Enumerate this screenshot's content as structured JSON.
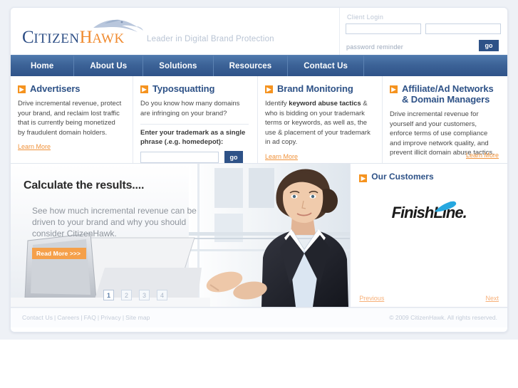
{
  "brand": {
    "name_first": "Citizen",
    "name_second": "Hawk",
    "tagline": "Leader in Digital Brand Protection",
    "hawk_icon": "hawk-icon",
    "accent_orange": "#f5931f",
    "accent_blue": "#2e5287"
  },
  "login": {
    "label": "Client Login",
    "username_value": "",
    "username_placeholder": "",
    "password_value": "",
    "password_placeholder": "",
    "reminder_link": "password reminder",
    "go_label": "go"
  },
  "nav": {
    "items": [
      {
        "label": "Home"
      },
      {
        "label": "About Us"
      },
      {
        "label": "Solutions"
      },
      {
        "label": "Resources"
      },
      {
        "label": "Contact Us"
      }
    ]
  },
  "features": [
    {
      "title": "Advertisers",
      "body": "Drive incremental revenue, protect your brand, and reclaim lost traffic that is currently being monetized by fraudulent domain holders.",
      "learn_more": "Learn More"
    },
    {
      "title": "Typosquatting",
      "body": "Do you know how many domains are infringing on your brand?",
      "prompt": "Enter your trademark as a single phrase (.e.g. homedepot):",
      "input_value": "",
      "input_placeholder": "",
      "go_label": "go"
    },
    {
      "title": "Brand Monitoring",
      "body_pre": "Identify ",
      "body_bold": "keyword abuse tactics",
      "body_post": " & who is bidding on your trademark terms or keywords, as well as, the use & placement of your trademark in ad copy.",
      "learn_more": "Learn More"
    },
    {
      "title": "Affiliate/Ad Networks & Domain Managers",
      "body": "Drive incremental revenue for yourself and your customers, enforce terms of use compliance and improve network quality, and prevent illicit domain abuse tactics.",
      "learn_more": "Learn More"
    }
  ],
  "hero": {
    "title": "Calculate the results....",
    "subtitle": "See how much incremental revenue can be driven to your brand and why you should consider CitizenHawk.",
    "read_more": "Read More >>>",
    "pager": [
      {
        "label": "1",
        "active": true
      },
      {
        "label": "2",
        "active": false
      },
      {
        "label": "3",
        "active": false
      },
      {
        "label": "4",
        "active": false
      }
    ],
    "image_alt": "businesswoman-at-laptop-photo"
  },
  "customers": {
    "title": "Our Customers",
    "logo_part1": "Finish",
    "logo_part2": "Line.",
    "previous_label": "Previous",
    "next_label": "Next"
  },
  "footer": {
    "links": [
      {
        "label": "Contact Us"
      },
      {
        "label": "Careers"
      },
      {
        "label": "FAQ"
      },
      {
        "label": "Privacy"
      },
      {
        "label": "Site map"
      }
    ],
    "copyright": "© 2009 CitizenHawk. All rights reserved."
  }
}
